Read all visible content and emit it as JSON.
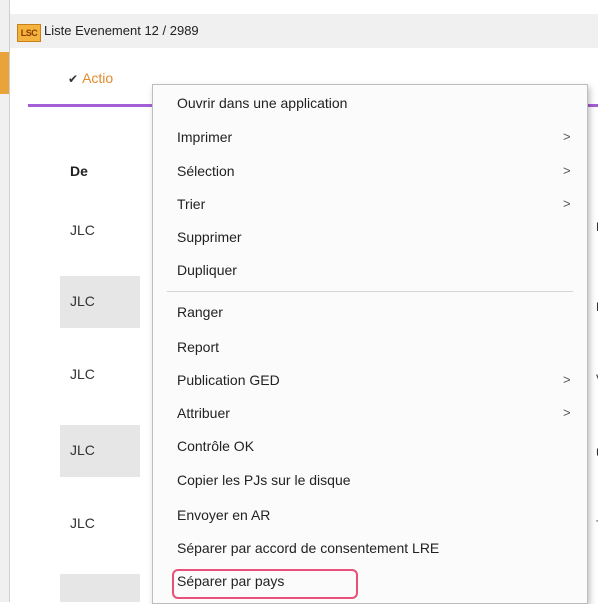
{
  "window": {
    "app_logo": "LSC",
    "title": "Liste  Evenement 12 / 2989"
  },
  "toolbar": {
    "action_label": "Actio",
    "action_chevron": "chevron-down-icon"
  },
  "table": {
    "column_header": "De",
    "rows": [
      {
        "value": "JLC"
      },
      {
        "value": "JLC"
      },
      {
        "value": "JLC"
      },
      {
        "value": "JLC"
      },
      {
        "value": "JLC"
      }
    ],
    "right_edge": [
      "D",
      "L",
      "V",
      "U",
      "T"
    ]
  },
  "context_menu": {
    "items": [
      {
        "label": "Ouvrir dans une application",
        "has_submenu": false
      },
      {
        "label": "Imprimer",
        "has_submenu": true
      },
      {
        "label": "Sélection",
        "has_submenu": true
      },
      {
        "label": "Trier",
        "has_submenu": true
      },
      {
        "label": "Supprimer",
        "has_submenu": false
      },
      {
        "label": "Dupliquer",
        "has_submenu": false
      },
      {
        "label": "Ranger",
        "has_submenu": false
      },
      {
        "label": "Report",
        "has_submenu": false
      },
      {
        "label": "Publication GED",
        "has_submenu": true
      },
      {
        "label": "Attribuer",
        "has_submenu": true
      },
      {
        "label": "Contrôle OK",
        "has_submenu": false
      },
      {
        "label": "Copier les PJs sur le disque",
        "has_submenu": false
      },
      {
        "label": "Envoyer en AR",
        "has_submenu": false
      },
      {
        "label": "Séparer par accord de consentement LRE",
        "has_submenu": false
      },
      {
        "label": "Séparer par pays",
        "has_submenu": false,
        "highlighted": true
      }
    ],
    "submenu_glyph": ">",
    "highlight_color": "#e8507a"
  },
  "colors": {
    "accent_orange": "#e38a2a",
    "accent_purple": "#a55fd6"
  }
}
